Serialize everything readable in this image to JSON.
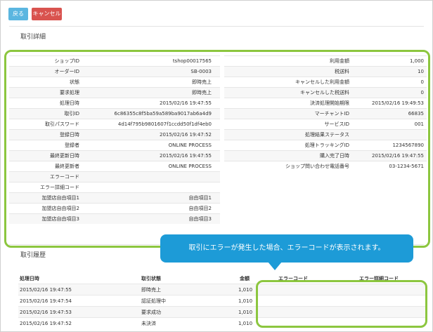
{
  "buttons": {
    "back": "戻る",
    "cancel": "キャンセル"
  },
  "section": {
    "detail": "取引詳細",
    "history": "取引履歴"
  },
  "details_left": [
    {
      "label": "ショップID",
      "value": "tshop00017565"
    },
    {
      "label": "オーダーID",
      "value": "SB-0003"
    },
    {
      "label": "状態",
      "value": "即時売上"
    },
    {
      "label": "要求処理",
      "value": "即時売上"
    },
    {
      "label": "処理日時",
      "value": "2015/02/16 19:47:55"
    },
    {
      "label": "取引ID",
      "value": "6c86355c8f5ba59a589ba9017ab6a4d9"
    },
    {
      "label": "取引パスワード",
      "value": "4d14f795b9801607f1ccdd50f1df4eb0"
    },
    {
      "label": "登録日時",
      "value": "2015/02/16 19:47:52"
    },
    {
      "label": "登録者",
      "value": "ONLINE PROCESS"
    },
    {
      "label": "最終更新日時",
      "value": "2015/02/16 19:47:55"
    },
    {
      "label": "最終更新者",
      "value": "ONLINE PROCESS"
    },
    {
      "label": "エラーコード",
      "value": ""
    },
    {
      "label": "エラー詳細コード",
      "value": ""
    },
    {
      "label": "加盟店自由項目1",
      "value": "自由項目1"
    },
    {
      "label": "加盟店自由項目2",
      "value": "自由項目2"
    },
    {
      "label": "加盟店自由項目3",
      "value": "自由項目3"
    }
  ],
  "details_right": [
    {
      "label": "利用金額",
      "value": "1,000"
    },
    {
      "label": "税送料",
      "value": "10"
    },
    {
      "label": "キャンセルした利用金額",
      "value": "0"
    },
    {
      "label": "キャンセルした税送料",
      "value": "0"
    },
    {
      "label": "決済処理開始期限",
      "value": "2015/02/16 19:49:53"
    },
    {
      "label": "マーチャントID",
      "value": "66835"
    },
    {
      "label": "サービスID",
      "value": "001"
    },
    {
      "label": "処理結果ステータス",
      "value": ""
    },
    {
      "label": "処理トラッキングID",
      "value": "1234567890"
    },
    {
      "label": "購入完了日時",
      "value": "2015/02/16 19:47:55"
    },
    {
      "label": "ショップ問い合わせ電話番号",
      "value": "03-1234-5671"
    }
  ],
  "history": {
    "headers": [
      "処理日時",
      "取引状態",
      "金額",
      "エラーコード",
      "エラー詳細コード"
    ],
    "rows": [
      {
        "datetime": "2015/02/16 19:47:55",
        "status": "即時売上",
        "amount": "1,010",
        "error": "",
        "error_detail": ""
      },
      {
        "datetime": "2015/02/16 19:47:54",
        "status": "認証処理中",
        "amount": "1,010",
        "error": "",
        "error_detail": ""
      },
      {
        "datetime": "2015/02/16 19:47:53",
        "status": "要求成功",
        "amount": "1,010",
        "error": "",
        "error_detail": ""
      },
      {
        "datetime": "2015/02/16 19:47:52",
        "status": "未決済",
        "amount": "1,010",
        "error": "",
        "error_detail": ""
      }
    ]
  },
  "callout": "取引にエラーが発生した場合、エラーコードが表示されます。",
  "colors": {
    "highlight": "#8cc63f",
    "callout": "#1d9bd7",
    "back_button": "#5bb6e0",
    "cancel_button": "#d9534f"
  }
}
